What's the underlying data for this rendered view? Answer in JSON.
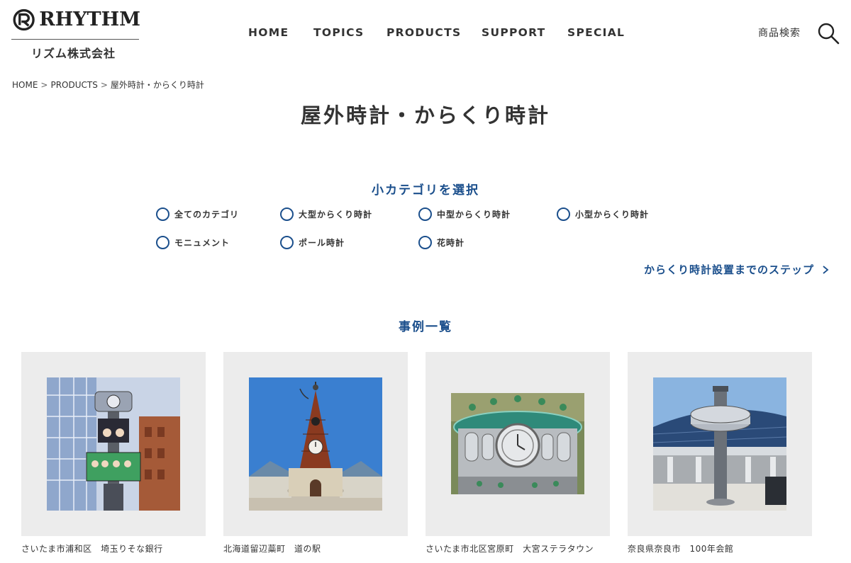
{
  "header": {
    "logo_text": "RHYTHM",
    "logo_subtext": "リズム株式会社",
    "nav": [
      "HOME",
      "TOPICS",
      "PRODUCTS",
      "SUPPORT",
      "SPECIAL"
    ],
    "search_label": "商品検索"
  },
  "breadcrumb": {
    "items": [
      "HOME",
      "PRODUCTS",
      "屋外時計・からくり時計"
    ],
    "separator": ">"
  },
  "page_title": "屋外時計・からくり時計",
  "category_select": {
    "heading": "小カテゴリを選択",
    "options": [
      "全てのカテゴリ",
      "大型からくり時計",
      "中型からくり時計",
      "小型からくり時計",
      "モニュメント",
      "ポール時計",
      "花時計"
    ]
  },
  "steps_link": "からくり時計設置までのステップ",
  "cases": {
    "heading": "事例一覧",
    "items": [
      {
        "caption": "さいたま市浦和区　埼玉りそな銀行"
      },
      {
        "caption": "北海道留辺蘂町　道の駅"
      },
      {
        "caption": "さいたま市北区宮原町　大宮ステラタウン"
      },
      {
        "caption": "奈良県奈良市　100年会館"
      }
    ]
  },
  "colors": {
    "accent": "#1b4f8c",
    "text": "#333333",
    "card_bg": "#ececec"
  }
}
